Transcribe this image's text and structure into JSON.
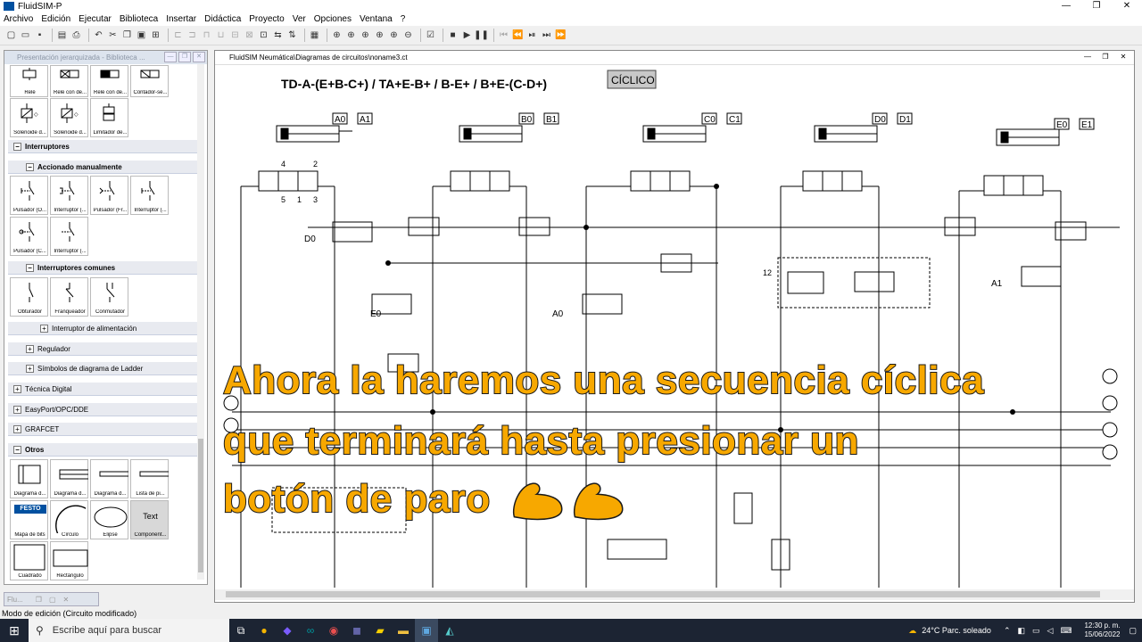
{
  "app": {
    "title": "FluidSIM-P",
    "logo_text": "FESTO"
  },
  "menu": [
    "Archivo",
    "Edición",
    "Ejecutar",
    "Biblioteca",
    "Insertar",
    "Didáctica",
    "Proyecto",
    "Ver",
    "Opciones",
    "Ventana",
    "?"
  ],
  "library": {
    "title": "Presentación jerarquizada - Biblioteca ...",
    "row1": [
      "Relé",
      "Relé con de...",
      "Relé con de...",
      "Contador-se..."
    ],
    "row2": [
      "Solenoide d...",
      "Solenoide d...",
      "Limitador de..."
    ],
    "groups": {
      "interruptores": "Interruptores",
      "accionado": "Accionado manualmente",
      "comunes": "Interruptores comunes",
      "alimentacion": "Interruptor de alimentación",
      "regulador": "Regulador",
      "ladder": "Símbolos de diagrama de Ladder",
      "digital": "Técnica Digital",
      "easyport": "EasyPort/OPC/DDE",
      "grafcet": "GRAFCET",
      "otros": "Otros"
    },
    "manual": [
      "Pulsador (O...",
      "Interruptor (...",
      "Pulsador (Fr...",
      "Interruptor (...",
      "Pulsador (C...",
      "Interruptor (..."
    ],
    "comunes_items": [
      "Obturador",
      "Franqueador",
      "Conmutador"
    ],
    "otros_items": [
      "Diagrama d...",
      "Diagrama d...",
      "Diagrama d...",
      "Lista de pi...",
      "Mapa de bits",
      "Círculo",
      "Elipse",
      "Component...",
      "Cuadrado",
      "Rectángulo"
    ],
    "text_tile": "Text"
  },
  "circuit_window": {
    "title": "FluidSIM Neumática\\Diagramas de circuitos\\noname3.ct",
    "sequence": "TD-A-(E+B-C+) / TA+E-B+ / B-E+ / B+E-(C-D+)",
    "cyclic_button": "CÍCLICO",
    "sensors": [
      "A0",
      "A1",
      "B0",
      "B1",
      "C0",
      "C1",
      "D0",
      "D1",
      "E0",
      "E1"
    ],
    "valve_labels": [
      "D0",
      "E0",
      "A0",
      "A1"
    ],
    "port_numbers": [
      "1",
      "2",
      "3",
      "4",
      "5",
      "12"
    ]
  },
  "caption": {
    "line1": "Ahora la haremos una secuencia cíclica",
    "line2": "que terminará hasta presionar un",
    "line3": "botón de paro"
  },
  "minimized_window": "Flu...",
  "status": "Modo de edición (Circuito modificado)",
  "taskbar": {
    "search_placeholder": "Escribe aquí para buscar",
    "weather": "24°C  Parc. soleado",
    "time": "12:30 p. m.",
    "date": "15/06/2022"
  }
}
